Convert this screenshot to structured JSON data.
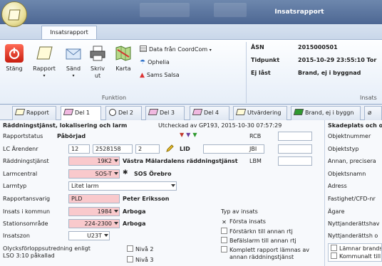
{
  "window": {
    "title": "Insatsrapport"
  },
  "ribbon": {
    "tab": "Insatsrapport",
    "buttons": {
      "stang": "Stäng",
      "rapport": "Rapport",
      "sand": "Sänd",
      "skriv_ut": "Skriv ut",
      "karta": "Karta"
    },
    "links": {
      "coordcom": "Data från CoordCom",
      "ophelia": "Ophelia",
      "sams": "Sams Salsa"
    },
    "group": "Funktion",
    "info": {
      "asn_label": "ÅSN",
      "asn_value": "2015000501",
      "tid_label": "Tidpunkt",
      "tid_value": "2015-10-29 23:55:10 Tor",
      "ejlast_label": "Ej låst",
      "ejlast_value": "Brand, ej i byggnad"
    },
    "group_right": "Insats"
  },
  "tabs": [
    "Rapport",
    "Del 1",
    "Del 2",
    "Del 3",
    "Del 4",
    "Utvärdering",
    "Brand, ej i byggn"
  ],
  "colors": {
    "accent": "#4d6793",
    "required": "#f9c9cc"
  },
  "form": {
    "section_title": "Räddningstjänst, lokalisering och larm",
    "checked_out": "Utcheckad av GP193, 2015-10-30 07:57:29",
    "status_label": "Rapportstatus",
    "status_value": "Påbörjad",
    "arende_label": "LC Ärendenr",
    "arende_1": "12",
    "arende_2": "2528158",
    "arende_3": "2",
    "lid_label": "LID",
    "rt_label": "Räddningstjänst",
    "rt_code": "19K2",
    "rt_name": "Västra Mälardalens räddningstjänst",
    "lc_label": "Larmcentral",
    "lc_code": "SOS-T",
    "lc_name": "SOS Örebro",
    "larmtyp_label": "Larmtyp",
    "larmtyp_value": "Litet larm",
    "ansvarig_label": "Rapportansvarig",
    "ansvarig_code": "PLD",
    "ansvarig_name": "Peter Eriksson",
    "kommun_label": "Insats i kommun",
    "kommun_code": "1984",
    "kommun_name": "Arboga",
    "station_label": "Stationsområde",
    "station_code": "224-2300",
    "station_name": "Arboga",
    "zon_label": "Insatszon",
    "zon_value": "U23T",
    "olycka_label": "Olycksförloppsutredning enligt LSO 3:10 påkallad",
    "niva2": "Nivå 2",
    "niva3": "Nivå 3",
    "rcb": "RCB",
    "jbi": "JBI",
    "lbm": "LBM",
    "typ_title": "Typ av insats",
    "typ_options": [
      "Första insats",
      "Förstärkn till annan rtj",
      "Befälslarm till annan rtj",
      "Komplett rapport lämnas av annan räddningstjänst"
    ]
  },
  "right": {
    "title": "Skadeplats och o",
    "fields": [
      "Objektnummer",
      "Objektstyp",
      "Annan, precisera",
      "Objektsnamn",
      "Adress",
      "Fastighet/CFD-nr",
      "Ägare",
      "Nyttjanderättshav",
      "Nyttjanderättsh o"
    ],
    "checks": [
      "Lämnar brands",
      "Kommunalt till"
    ]
  }
}
